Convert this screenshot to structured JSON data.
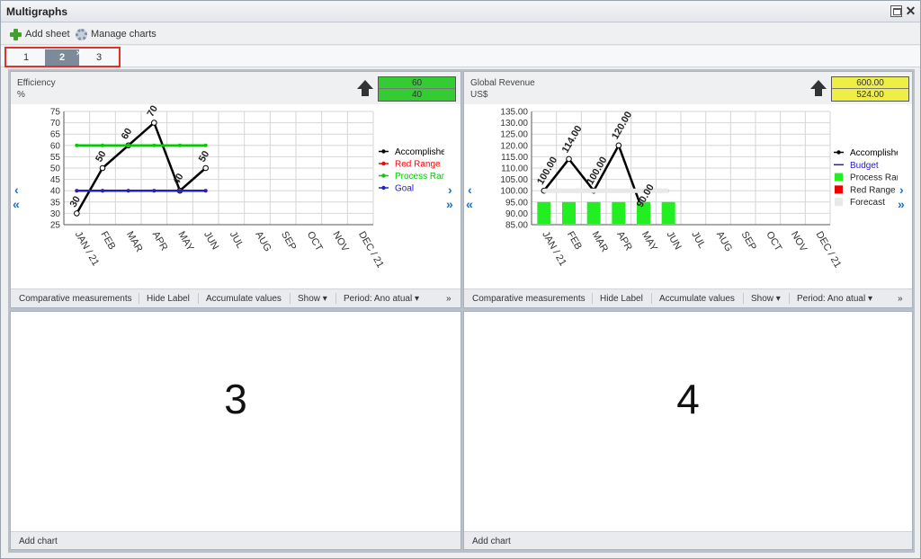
{
  "window": {
    "title": "Multigraphs"
  },
  "toolbar": {
    "add_sheet": "Add sheet",
    "manage_charts": "Manage charts"
  },
  "tabs": [
    {
      "label": "1"
    },
    {
      "label": "2"
    },
    {
      "label": "3"
    }
  ],
  "active_tab": "2",
  "panels": {
    "efficiency": {
      "title": "Efficiency",
      "unit": "%",
      "value_top": "60",
      "value_bottom": "40",
      "box_color": "#33cc33"
    },
    "revenue": {
      "title": "Global Revenue",
      "unit": "US$",
      "value_top": "600.00",
      "value_bottom": "524.00",
      "box_color": "#eeee44"
    },
    "empty3": {
      "number": "3",
      "add_chart": "Add chart"
    },
    "empty4": {
      "number": "4",
      "add_chart": "Add chart"
    }
  },
  "footer": {
    "comparative": "Comparative measurements",
    "hide_label": "Hide Label",
    "accumulate": "Accumulate values",
    "show": "Show ▾",
    "period": "Period: Ano atual ▾",
    "more": "»"
  },
  "chart_data": [
    {
      "type": "line",
      "x": [
        "JAN / 21",
        "FEB",
        "MAR",
        "APR",
        "MAY",
        "JUN",
        "JUL",
        "AUG",
        "SEP",
        "OCT",
        "NOV",
        "DEC / 21"
      ],
      "series": [
        {
          "name": "Accomplished",
          "values": [
            30,
            50,
            60,
            70,
            40,
            50
          ],
          "color": "#000000"
        },
        {
          "name": "Red Range",
          "values": [
            40,
            40,
            40,
            40,
            40,
            40
          ],
          "color": "#ff0000"
        },
        {
          "name": "Process Range",
          "values": [
            60,
            60,
            60,
            60,
            60,
            60
          ],
          "color": "#00cc00"
        },
        {
          "name": "Goal",
          "values": [
            40,
            40,
            40,
            40,
            40,
            40
          ],
          "color": "#2020cc"
        }
      ],
      "data_labels": [
        "30",
        "50",
        "60",
        "70",
        "40",
        "50"
      ],
      "y_ticks": [
        "25",
        "30",
        "35",
        "40",
        "45",
        "50",
        "55",
        "60",
        "65",
        "70",
        "75"
      ],
      "ylim": [
        25,
        75
      ],
      "grid": true,
      "legend": "right"
    },
    {
      "type": "line",
      "x": [
        "JAN / 21",
        "FEB",
        "MAR",
        "APR",
        "MAY",
        "JUN",
        "JUL",
        "AUG",
        "SEP",
        "OCT",
        "NOV",
        "DEC / 21"
      ],
      "series": [
        {
          "name": "Accomplished",
          "values": [
            100.0,
            114.0,
            100.0,
            120.0,
            90.0
          ],
          "color": "#000000"
        },
        {
          "name": "Budget",
          "values": [
            100.0,
            100.0,
            100.0,
            100.0,
            100.0,
            100.0
          ],
          "color": "#2020cc"
        },
        {
          "name": "Process Range",
          "values": [
            95.0,
            95.0,
            95.0,
            95.0,
            95.0,
            95.0
          ],
          "color": "#22ee22"
        },
        {
          "name": "Red Range",
          "values": [],
          "color": "#ee0000"
        },
        {
          "name": "Forecast",
          "values": [
            100.0,
            100.0,
            100.0,
            100.0,
            100.0,
            100.0
          ],
          "color": "#e8e8e8"
        }
      ],
      "data_labels": [
        "100.00",
        "114.00",
        "100.00",
        "120.00",
        "90.00"
      ],
      "y_ticks": [
        "85.00",
        "90.00",
        "95.00",
        "100.00",
        "105.00",
        "110.00",
        "115.00",
        "120.00",
        "125.00",
        "130.00",
        "135.00"
      ],
      "ylim": [
        85,
        135
      ],
      "grid": true,
      "legend": "right"
    }
  ]
}
